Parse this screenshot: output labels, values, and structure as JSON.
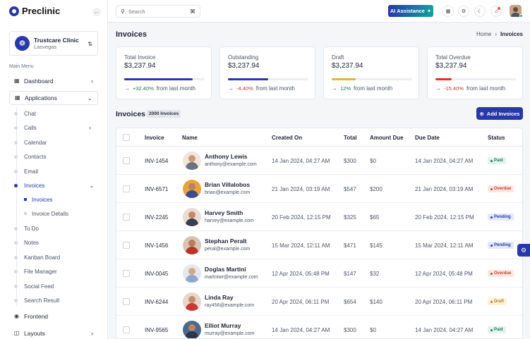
{
  "brand": {
    "name": "Preclinic"
  },
  "clinic": {
    "name": "Trustcare Clinic",
    "location": "Lasvegas"
  },
  "sidebar": {
    "menu_title": "Main Menu",
    "dashboard": "Dashboard",
    "applications": "Applications",
    "sub_items": [
      "Chat",
      "Calls",
      "Calendar",
      "Contacts",
      "Email",
      "Invoices"
    ],
    "invoice_children": [
      "Invoices",
      "Invoice Details"
    ],
    "more_items": [
      "To Do",
      "Notes",
      "Kanban Board",
      "File Manager",
      "Social Feed",
      "Search Result"
    ],
    "frontend": "Frontend",
    "layouts": "Layouts"
  },
  "topbar": {
    "search_placeholder": "Search",
    "ai_label": "AI Assistance"
  },
  "page": {
    "title": "Invoices",
    "breadcrumb_home": "Home",
    "breadcrumb_current": "Invoices"
  },
  "stats": [
    {
      "label": "Total Invoice",
      "value": "$3,237.94",
      "trend": "+32.40%",
      "suffix": "from last month",
      "progress": 0.85,
      "color": "#2838a8",
      "trend_color": "#1e7a52"
    },
    {
      "label": "Outstanding",
      "value": "$3,237.94",
      "trend": "-4.40%",
      "suffix": "from last month",
      "progress": 0.5,
      "color": "#2838a8",
      "trend_color": "#c2412d"
    },
    {
      "label": "Draft",
      "value": "$3,237.94",
      "trend": "12%",
      "suffix": "from last month",
      "progress": 0.3,
      "color": "#e5b04a",
      "trend_color": "#1e7a52"
    },
    {
      "label": "Total Overdue",
      "value": "$3,237.94",
      "trend": "-15.40%",
      "suffix": "from last month",
      "progress": 0.2,
      "color": "#e2331f",
      "trend_color": "#c2412d"
    }
  ],
  "invoices_section": {
    "title": "Invoices",
    "count": "2000 Invoices",
    "add_label": "Add Invoices"
  },
  "table": {
    "headers": [
      "Invoice",
      "Name",
      "Created On",
      "Total",
      "Amount Due",
      "Due Date",
      "Status"
    ],
    "rows": [
      {
        "invoice": "INV-1454",
        "name": "Anthony Lewis",
        "email": "anthony@example.com",
        "created": "14 Jan 2024, 04:27 AM",
        "total": "$300",
        "due_amount": "$0",
        "due_date": "14 Jan 2024, 04:27 AM",
        "status": "Paid",
        "status_key": "paid",
        "skin": "#c99a7a",
        "shirt": "#6b7280",
        "bg": "#f0e6dc"
      },
      {
        "invoice": "INV-6571",
        "name": "Brian Villalobos",
        "email": "brian@example.com",
        "created": "21 Jan 2024, 03:19 AM",
        "total": "$547",
        "due_amount": "$200",
        "due_date": "21 Jan 2024, 03:19 AM",
        "status": "Overdue",
        "status_key": "overdue",
        "skin": "#b9825f",
        "shirt": "#3c4a8f",
        "bg": "#e9a33b"
      },
      {
        "invoice": "INV-2245",
        "name": "Harvey Smith",
        "email": "harvey@example.com",
        "created": "20 Feb 2024, 12:15 PM",
        "total": "$325",
        "due_amount": "$65",
        "due_date": "20 Feb 2024, 12:15 PM",
        "status": "Pending",
        "status_key": "pending",
        "skin": "#c08a6a",
        "shirt": "#3a3f4c",
        "bg": "#ecdcd2"
      },
      {
        "invoice": "INV-1456",
        "name": "Stephan Peralt",
        "email": "peral@example.com",
        "created": "15 Mar 2024, 12:11 AM",
        "total": "$471",
        "due_amount": "$145",
        "due_date": "15 Mar 2024, 12:11 AM",
        "status": "Pending",
        "status_key": "pending",
        "skin": "#b57b5a",
        "shirt": "#b8332a",
        "bg": "#d9c4b4"
      },
      {
        "invoice": "INV-0045",
        "name": "Doglas Martini",
        "email": "martniwr@example.com",
        "created": "12 Apr 2024, 05:48 PM",
        "total": "$147",
        "due_amount": "$32",
        "due_date": "12 Apr 2024, 05:48 PM",
        "status": "Overdue",
        "status_key": "overdue",
        "skin": "#d1a78a",
        "shirt": "#8fa6c9",
        "bg": "#e4e8ee"
      },
      {
        "invoice": "INV-6244",
        "name": "Linda Ray",
        "email": "ray456@example.com",
        "created": "20 Apr 2024, 06:11 PM",
        "total": "$654",
        "due_amount": "$140",
        "due_date": "20 Apr 2024, 06:11 PM",
        "status": "Draft",
        "status_key": "draft",
        "skin": "#c48d6c",
        "shirt": "#c83a35",
        "bg": "#e8d7c9"
      },
      {
        "invoice": "INV-9565",
        "name": "Elliot Murray",
        "email": "murray@example.com",
        "created": "14 Jan 2024, 04:27 AM",
        "total": "$300",
        "due_amount": "$0",
        "due_date": "14 Jan 2024, 04:27 AM",
        "status": "Paid",
        "status_key": "paid",
        "skin": "#b98566",
        "shirt": "#2a3550",
        "bg": "#4a6a8a"
      }
    ]
  }
}
